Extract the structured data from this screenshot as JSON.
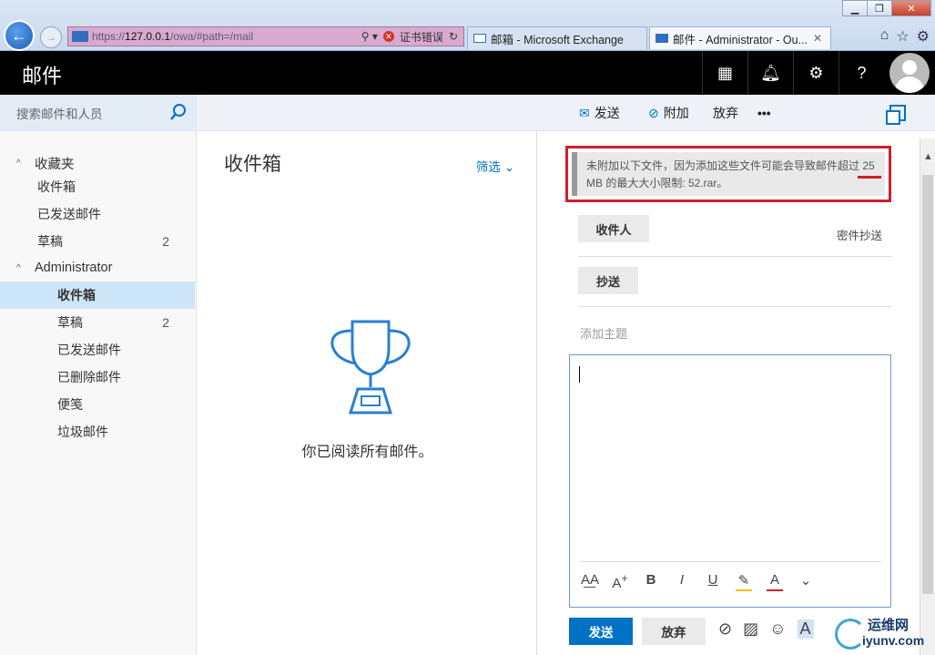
{
  "browser": {
    "url_prefix": "https://",
    "url_host": "127.0.0.1",
    "url_path": "/owa/#path=/mail",
    "cert_error": "证书错误",
    "tabs": [
      {
        "label": "邮箱 - Microsoft Exchange"
      },
      {
        "label": "邮件 - Administrator - Ou..."
      }
    ]
  },
  "header": {
    "title": "邮件"
  },
  "search": {
    "placeholder": "搜索邮件和人员"
  },
  "commands": {
    "send": "发送",
    "attach": "附加",
    "discard": "放弃",
    "more": "•••"
  },
  "folders": {
    "favorites_label": "收藏夹",
    "favorites": [
      {
        "label": "收件箱",
        "count": ""
      },
      {
        "label": "已发送邮件",
        "count": ""
      },
      {
        "label": "草稿",
        "count": "2"
      }
    ],
    "account_label": "Administrator",
    "account": [
      {
        "label": "收件箱",
        "count": ""
      },
      {
        "label": "草稿",
        "count": "2"
      },
      {
        "label": "已发送邮件",
        "count": ""
      },
      {
        "label": "已删除邮件",
        "count": ""
      },
      {
        "label": "便笺",
        "count": ""
      },
      {
        "label": "垃圾邮件",
        "count": ""
      }
    ]
  },
  "list": {
    "title": "收件箱",
    "filter": "筛选",
    "empty_text": "你已阅读所有邮件。"
  },
  "compose": {
    "warning": "未附加以下文件，因为添加这些文件可能会导致邮件超过 25 MB 的最大大小限制: 52.rar。",
    "to_label": "收件人",
    "bcc_link": "密件抄送",
    "cc_label": "抄送",
    "subject_placeholder": "添加主题",
    "send": "发送",
    "discard": "放弃"
  },
  "watermark": {
    "line1": "运维网",
    "line2": "iyunv.com"
  },
  "colors": {
    "accent": "#0072c6",
    "warning_border": "#d21f2a",
    "selected_folder": "#cde6f7",
    "header_bg": "#000000"
  }
}
